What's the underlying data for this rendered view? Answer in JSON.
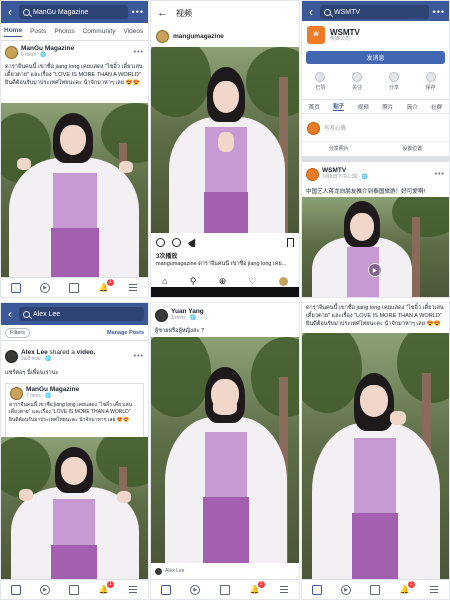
{
  "thai_caption_line1": "ดาราจีนคนนี้ เขาชื่อ jiang long เคยแสดง \"ไซอิ๋ว เดี๋ยวเล่นเดี๋ยวตาย\" และเรื่อง \"LOVE IS MORE THAN A WORLD\"",
  "thai_caption_line2": "ยินดีต้อนรับมาประเทศไทยนะคะ น้าจักมาหาๆ เลย 😍😍",
  "colors": {
    "fb_blue": "#3b5998",
    "badge_red": "#fa3e3e",
    "wsm_orange": "#f07b27",
    "robe_purple": "#a35fb0"
  },
  "fb_nav": {
    "icons": [
      "home-icon",
      "video-icon",
      "marketplace-icon",
      "bell-icon",
      "menu-icon"
    ],
    "badge": "1"
  },
  "panel1": {
    "search": "ManGu Magazine",
    "tabs": [
      "Home",
      "Posts",
      "Photos",
      "Community",
      "Videos"
    ],
    "page_name": "ManGu Magazine",
    "time": "6 mins · 🌐"
  },
  "panel2": {
    "title": "视频",
    "account": "mangumagazine",
    "likes": "3次播放",
    "caption": "mangumagazine ดาราจีนคนนี้ เขาชื่อ jiang long เคย..."
  },
  "panel3": {
    "search": "WSMTV",
    "page_name": "WSMTV",
    "page_type": "传媒公司",
    "message_button": "发消息",
    "actions": [
      "已赞",
      "关注",
      "分享",
      "保存"
    ],
    "tabs": [
      "首页",
      "贴子",
      "视频",
      "照片",
      "简介",
      "社群"
    ],
    "compose_placeholder": "写写心情",
    "split": [
      "分享照片",
      "设置位置"
    ],
    "post_name": "WSMTV",
    "post_time": "7月8日下午1:36 · 🌐",
    "post_caption": "中国艺人蒋龙向朋友推介到泰国旅游！好可爱啊!"
  },
  "panel4": {
    "search": "Alex Lee",
    "filters": "Filters",
    "manage": "Manage Posts",
    "sharer_name": "Alex Lee",
    "sharer_action": " shared a ",
    "sharer_obj": "video.",
    "sharer_time": "Just now · 🌐",
    "share_text": "แชร์ต่อๆ นี่เพื่อนเรานะ",
    "inner_page": "ManGu Magazine",
    "inner_time": "7 mins · 🌐"
  },
  "panel5": {
    "name": "Yuan Yang",
    "time": "3 mins · 🌐",
    "caption": "ผู้ชายหรือผู้หญิงล่ะ ?",
    "footer_name": "Alex Lee"
  }
}
